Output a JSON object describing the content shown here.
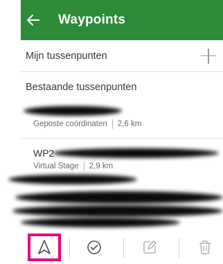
{
  "header": {
    "title": "Waypoints",
    "bg_color": "#2e8b3a"
  },
  "sections": {
    "mijn_label": "Mijn tussenpunten",
    "bestaande_label": "Bestaande tussenpunten"
  },
  "waypoints": [
    {
      "name": "",
      "meta_type": "Geposte coördinaten",
      "distance": "2,6 km"
    },
    {
      "name": "WP2",
      "meta_type": "Virtual Stage",
      "distance": "2,9 km"
    }
  ],
  "toolbar": {
    "highlight_color": "#e6007e",
    "icons": [
      "navigate-icon",
      "check-circle-icon",
      "edit-icon",
      "delete-icon"
    ]
  }
}
